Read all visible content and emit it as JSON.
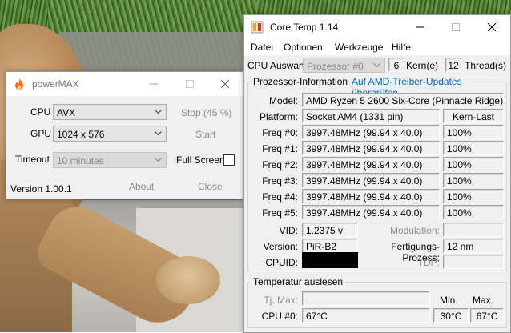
{
  "powermax": {
    "title": "powerMAX",
    "cpu_label": "CPU",
    "cpu_value": "AVX",
    "gpu_label": "GPU",
    "gpu_value": "1024 x 576",
    "timeout_label": "Timeout",
    "timeout_value": "10 minutes",
    "stop_label": "Stop (45 %)",
    "start_label": "Start",
    "fullscreen_label": "Full Screen",
    "fullscreen_checked": false,
    "version": "Version 1.00.1",
    "about_label": "About",
    "close_label": "Close"
  },
  "coretemp": {
    "title": "Core Temp 1.14",
    "menu": [
      "Datei",
      "Optionen",
      "Werkzeuge",
      "Hilfe"
    ],
    "cpu_select_label": "CPU Auswahl:",
    "cpu_select_value": "Prozessor #0",
    "cores_value": "6",
    "cores_label": "Kern(e)",
    "threads_value": "12",
    "threads_label": "Thread(s)",
    "info_tab": "Prozessor-Information",
    "driver_link": "Auf AMD-Treiber-Updates überprüfen",
    "model_label": "Model:",
    "model_value": "AMD Ryzen 5 2600 Six-Core (Pinnacle Ridge)",
    "platform_label": "Platform:",
    "platform_value": "Socket AM4 (1331 pin)",
    "load_header": "Kern-Last",
    "freqs": [
      {
        "label": "Freq #0:",
        "value": "3997.48MHz (99.94 x 40.0)",
        "load": "100%"
      },
      {
        "label": "Freq #1:",
        "value": "3997.48MHz (99.94 x 40.0)",
        "load": "100%"
      },
      {
        "label": "Freq #2:",
        "value": "3997.48MHz (99.94 x 40.0)",
        "load": "100%"
      },
      {
        "label": "Freq #3:",
        "value": "3997.48MHz (99.94 x 40.0)",
        "load": "100%"
      },
      {
        "label": "Freq #4:",
        "value": "3997.48MHz (99.94 x 40.0)",
        "load": "100%"
      },
      {
        "label": "Freq #5:",
        "value": "3997.48MHz (99.94 x 40.0)",
        "load": "100%"
      }
    ],
    "vid_label": "VID:",
    "vid_value": "1.2375 v",
    "modulation_label": "Modulation:",
    "modulation_value": "",
    "version_label": "Version:",
    "version_value": "PiR-B2",
    "process_label": "Fertigungs-Prozess:",
    "process_value": "12 nm",
    "cpuid_label": "CPUID:",
    "tdp_label": "TDP:",
    "tdp_value": "",
    "temp_group": "Temperatur auslesen",
    "tjmax_label": "Tj. Max:",
    "tjmax_value": "",
    "min_header": "Min.",
    "max_header": "Max.",
    "cpu0_label": "CPU #0:",
    "cpu0_value": "67°C",
    "cpu0_min": "30°C",
    "cpu0_max": "67°C"
  },
  "colors": {
    "link": "#0066cc",
    "powermax_icon": "#f26b1d",
    "cpuid_redacted": "#000000"
  }
}
